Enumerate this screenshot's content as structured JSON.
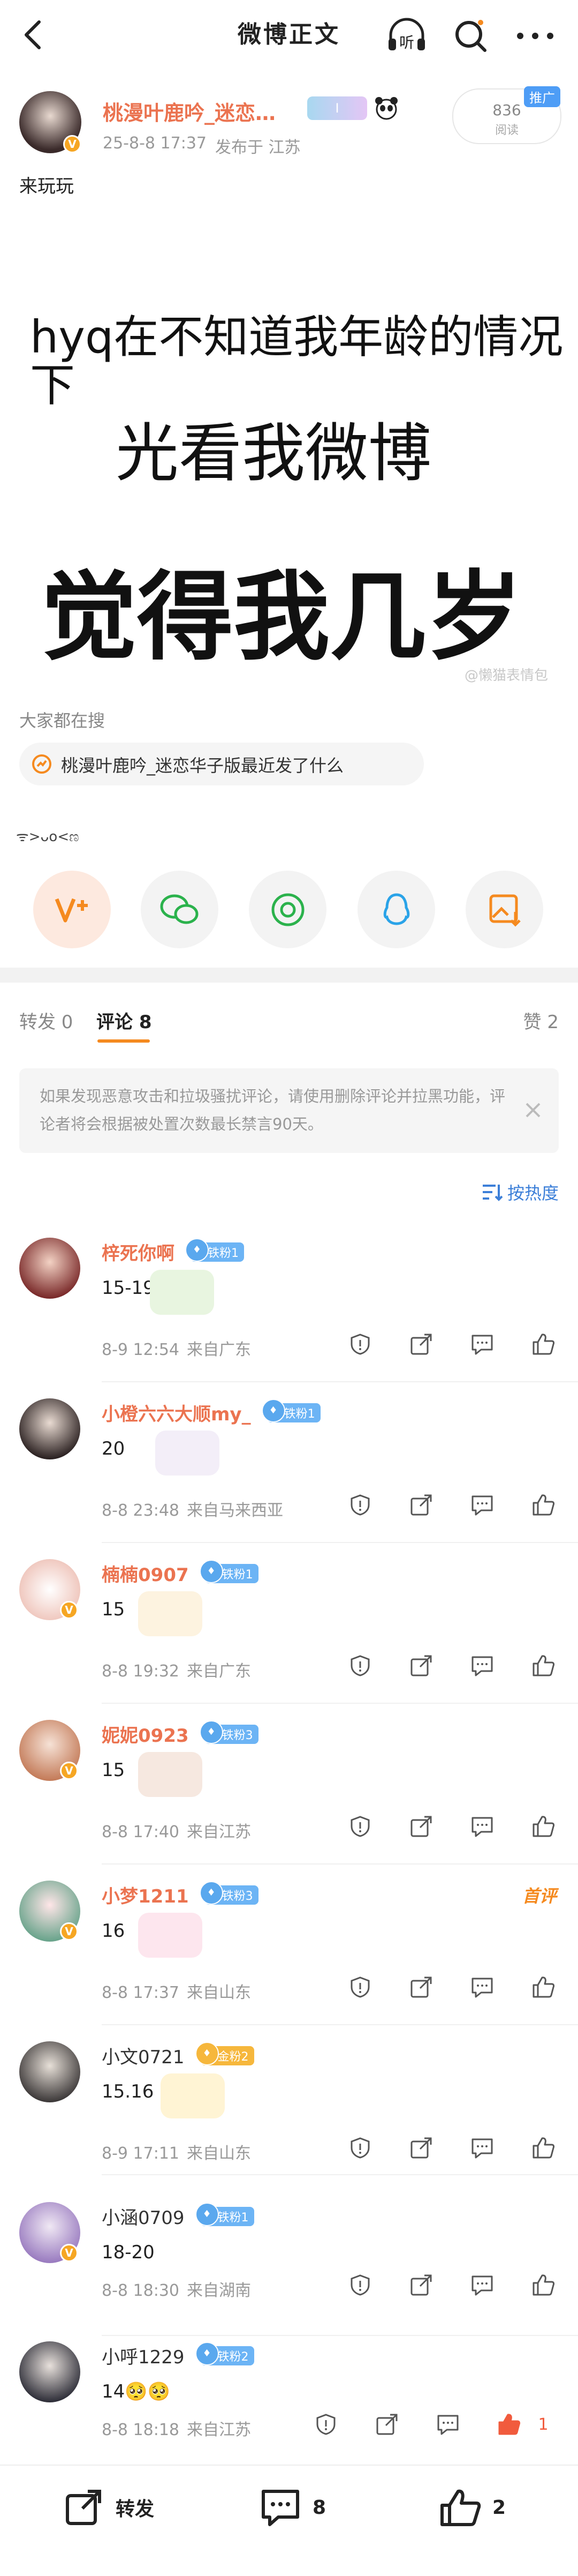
{
  "header": {
    "title": "微博正文",
    "back_icon": "back-arrow-icon",
    "listen_label": "听",
    "search_icon": "search-icon",
    "more_icon": "more-icon"
  },
  "post": {
    "author": "桃漫叶鹿吟_迷恋…",
    "badge": "I",
    "time": "25-8-8 17:37",
    "location": "发布于 江苏",
    "promo_label": "推广",
    "reads_count": "836",
    "reads_label": "阅读",
    "text": "来玩玩",
    "image_lines": [
      "hyq在不知道我年龄的情况",
      "下",
      "光看我微博",
      "觉得我几岁"
    ],
    "watermark": "@懒猫表情包"
  },
  "search_section": {
    "title": "大家都在搜",
    "suggestion": "桃漫叶鹿吟_迷恋华子版最近发了什么",
    "emoticon": "ᯤ>ᴗo<ಣ"
  },
  "share_icons": [
    "super-topic-icon",
    "wechat-icon",
    "moments-icon",
    "qq-icon",
    "save-image-icon"
  ],
  "tabs": {
    "repost": "转发 0",
    "comments": "评论 8",
    "likes": "赞 2"
  },
  "notice": "如果发现恶意攻击和拉圾骚扰评论，请使用删除评论并拉黑功能，评论者将会根据被处置次数最长禁言90天。",
  "sort_label": "按热度",
  "comments": [
    {
      "name": "梓死你啊",
      "badge": "铁粉1",
      "text": "15-19😁",
      "time": "8-9 12:54",
      "location": "来自广东"
    },
    {
      "name": "小橙六六大顺my_",
      "badge": "铁粉1",
      "text": "20",
      "time": "8-8 23:48",
      "location": "来自马来西亚"
    },
    {
      "name": "楠楠0907",
      "badge": "铁粉1",
      "text": "15",
      "time": "8-8 19:32",
      "location": "来自广东"
    },
    {
      "name": "妮妮0923",
      "badge": "铁粉3",
      "text": "15",
      "time": "8-8 17:40",
      "location": "来自江苏"
    },
    {
      "name": "小梦1211",
      "badge": "铁粉3",
      "text": "16",
      "time": "8-8 17:37",
      "location": "来自山东",
      "tag": "首评"
    },
    {
      "name": "小文0721",
      "badge": "金粉2",
      "text": "15.16",
      "time": "8-9 17:11",
      "location": "来自山东"
    },
    {
      "name": "小涵0709",
      "badge": "铁粉1",
      "text": "18-20",
      "time": "8-8 18:30",
      "location": "来自湖南"
    },
    {
      "name": "小呼1229",
      "badge": "铁粉2",
      "text": "14🥺🥺",
      "time": "8-8 18:18",
      "location": "来自江苏",
      "likes": "1"
    }
  ],
  "bottom_bar": {
    "repost": "转发",
    "comments": "8",
    "likes": "2"
  },
  "colors": {
    "accent_orange": "#eb7350",
    "fan_blue": "#6cb4f5",
    "gold": "#f6b73c",
    "like_red": "#f15b3d"
  }
}
